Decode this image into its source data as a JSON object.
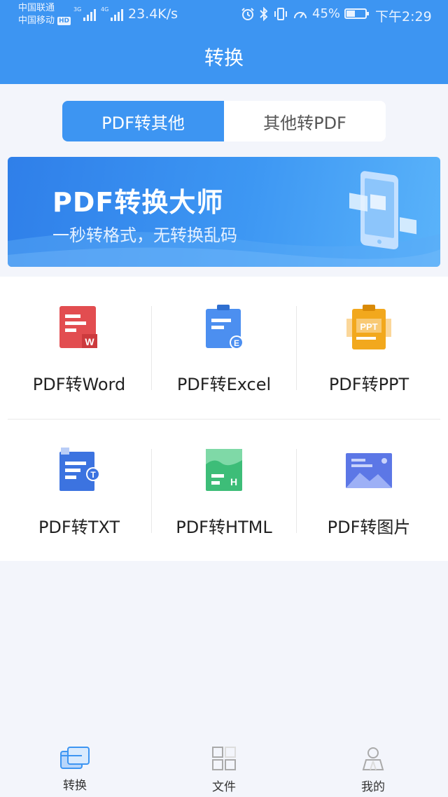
{
  "status_bar": {
    "carrier1": "中国联通",
    "carrier2": "中国移动",
    "hd": "HD",
    "net1": "3G",
    "net2": "4G",
    "net_speed": "23.4K/s",
    "battery_text": "45%",
    "battery_level": 0.45,
    "time": "下午2:29",
    "icons": [
      "alarm-icon",
      "bluetooth-icon",
      "vibrate-icon",
      "speed-gauge-icon",
      "battery-icon"
    ]
  },
  "header": {
    "title": "转换"
  },
  "mode_tabs": [
    {
      "label": "PDF转其他",
      "active": true
    },
    {
      "label": "其他转PDF",
      "active": false
    }
  ],
  "banner": {
    "title": "PDF转换大师",
    "subtitle": "一秒转格式，无转换乱码"
  },
  "tools": [
    {
      "label": "PDF转Word",
      "icon": "word-doc-icon",
      "badge": "W",
      "color": "#e24d50"
    },
    {
      "label": "PDF转Excel",
      "icon": "excel-doc-icon",
      "badge": "E",
      "color": "#4c8ff0"
    },
    {
      "label": "PDF转PPT",
      "icon": "ppt-doc-icon",
      "badge": "PPT",
      "color": "#f2a81d"
    },
    {
      "label": "PDF转TXT",
      "icon": "txt-doc-icon",
      "badge": "T",
      "color": "#3c73e0"
    },
    {
      "label": "PDF转HTML",
      "icon": "html-doc-icon",
      "badge": "H",
      "color": "#3dbd78"
    },
    {
      "label": "PDF转图片",
      "icon": "image-icon",
      "badge": "",
      "color": "#5c77e6"
    }
  ],
  "tab_bar": [
    {
      "label": "转换",
      "icon": "convert-icon",
      "active": true
    },
    {
      "label": "文件",
      "icon": "files-grid-icon",
      "active": false
    },
    {
      "label": "我的",
      "icon": "profile-icon",
      "active": false
    }
  ]
}
